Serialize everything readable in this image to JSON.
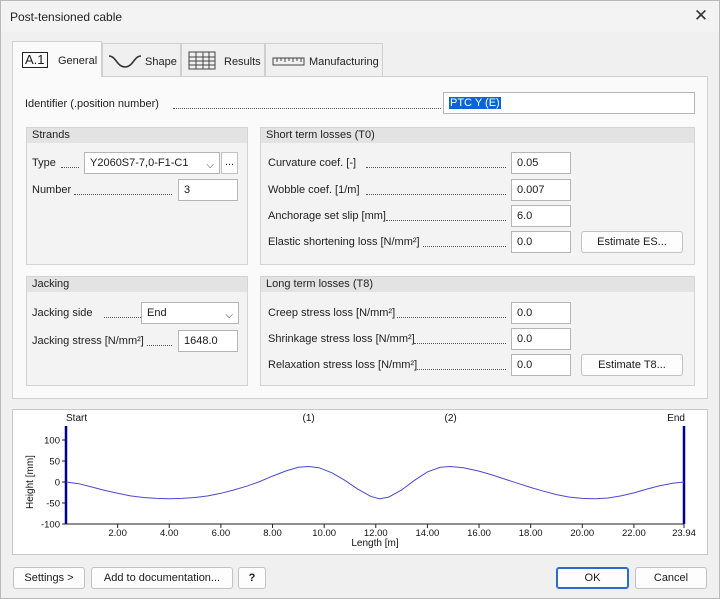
{
  "window": {
    "title": "Post-tensioned cable"
  },
  "tabs": [
    {
      "label": "General"
    },
    {
      "label": "Shape"
    },
    {
      "label": "Results"
    },
    {
      "label": "Manufacturing"
    }
  ],
  "tab_icon_text": "A.1",
  "identifier": {
    "label": "Identifier (.position number)",
    "value": "PTC Y (E)"
  },
  "strands": {
    "title": "Strands",
    "type_label": "Type",
    "type_value": "Y2060S7-7,0-F1-C1",
    "more_button": "...",
    "number_label": "Number",
    "number_value": "3"
  },
  "short_term": {
    "title": "Short term losses (T0)",
    "rows": [
      {
        "label": "Curvature coef. [-]",
        "value": "0.05"
      },
      {
        "label": "Wobble coef. [1/m]",
        "value": "0.007"
      },
      {
        "label": "Anchorage set slip [mm]",
        "value": "6.0"
      },
      {
        "label": "Elastic shortening loss [N/mm²]",
        "value": "0.0"
      }
    ],
    "estimate_button": "Estimate ES..."
  },
  "jacking": {
    "title": "Jacking",
    "side_label": "Jacking side",
    "side_value": "End",
    "stress_label": "Jacking stress [N/mm²]",
    "stress_value": "1648.0"
  },
  "long_term": {
    "title": "Long term losses (T8)",
    "rows": [
      {
        "label": "Creep stress loss [N/mm²]",
        "value": "0.0"
      },
      {
        "label": "Shrinkage stress loss [N/mm²]",
        "value": "0.0"
      },
      {
        "label": "Relaxation stress loss [N/mm²]",
        "value": "0.0"
      }
    ],
    "estimate_button": "Estimate T8..."
  },
  "chart_data": {
    "type": "line",
    "xlabel": "Length [m]",
    "ylabel": "Height [mm]",
    "xlim": [
      0,
      23.94
    ],
    "ylim": [
      -100,
      100
    ],
    "x_ticks": [
      2,
      4,
      6,
      8,
      10,
      12,
      14,
      16,
      18,
      20,
      22,
      23.94
    ],
    "x_tick_labels": [
      "2.00",
      "4.00",
      "6.00",
      "8.00",
      "10.00",
      "12.00",
      "14.00",
      "16.00",
      "18.00",
      "20.00",
      "22.00",
      "23.94"
    ],
    "y_ticks": [
      100,
      50,
      0,
      -50,
      -100
    ],
    "y_tick_labels": [
      "100",
      "50",
      "0",
      "-50",
      "-100"
    ],
    "markers": [
      {
        "label": "Start",
        "x": 0
      },
      {
        "label": "(1)",
        "x": 9.4
      },
      {
        "label": "(2)",
        "x": 14.9
      },
      {
        "label": "End",
        "x": 23.94
      }
    ],
    "series": [
      {
        "color": "#4a4ad0",
        "x": [
          0,
          0.5,
          1.0,
          1.5,
          2.0,
          2.5,
          3.0,
          3.5,
          4.0,
          4.5,
          5.0,
          5.5,
          6.0,
          6.5,
          7.0,
          7.5,
          8.0,
          8.5,
          9.0,
          9.4,
          9.8,
          10.3,
          10.8,
          11.3,
          11.8,
          12.15,
          12.5,
          13.0,
          13.5,
          14.0,
          14.5,
          14.9,
          15.4,
          16.0,
          16.5,
          17.0,
          17.5,
          18.0,
          18.5,
          19.0,
          19.5,
          20.0,
          20.5,
          21.0,
          21.5,
          22.0,
          22.5,
          23.0,
          23.5,
          23.94
        ],
        "y": [
          0,
          -4,
          -12,
          -20,
          -27,
          -33,
          -37,
          -39,
          -40,
          -39,
          -37,
          -33,
          -27,
          -19,
          -10,
          1,
          14,
          26,
          35,
          37,
          34,
          22,
          4,
          -17,
          -34,
          -40,
          -36,
          -19,
          4,
          24,
          35,
          37,
          34,
          26,
          17,
          7,
          -3,
          -13,
          -22,
          -30,
          -36,
          -39,
          -40,
          -38,
          -33,
          -26,
          -17,
          -9,
          -3,
          0
        ]
      }
    ]
  },
  "footer": {
    "settings_button": "Settings >",
    "documentation_button": "Add to documentation...",
    "help_button": "?",
    "ok_button": "OK",
    "cancel_button": "Cancel"
  },
  "colors": {
    "accent": "#0a64d6",
    "ok_border": "#2a6bd0",
    "plot_line": "#4a4ad0",
    "end_marker": "#00008b"
  }
}
